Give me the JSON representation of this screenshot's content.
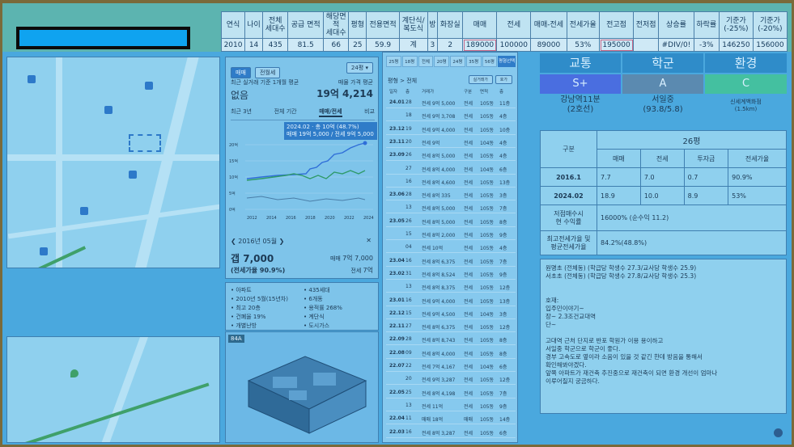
{
  "top_table": {
    "headers": [
      "연식",
      "나이",
      "전체\n세대수",
      "공급 면적",
      "해당면\n적\n세대수",
      "평형",
      "전용면적",
      "계단식/\n복도식",
      "방",
      "화장실",
      "매매",
      "전세",
      "매매-전세",
      "전세가율",
      "전고점",
      "전저점",
      "상승률",
      "하락률",
      "기준가\n(-25%)",
      "기준가\n(-20%)"
    ],
    "values": [
      "2010",
      "14",
      "435",
      "81.5",
      "66",
      "25",
      "59.9",
      "계",
      "3",
      "2",
      "189000",
      "100000",
      "89000",
      "53%",
      "195000",
      "",
      "#DIV/0!",
      "-3%",
      "146250",
      "156000"
    ]
  },
  "chart_panel": {
    "tab_sale": "매매",
    "tab_rent": "전월세",
    "size_select": "24평",
    "recent_label": "최근 실거래 기준 1개월 평균",
    "recent_value": "없음",
    "avg_label": "매물 가격 평균",
    "avg_value": "19억 4,214",
    "periods": [
      "최근 3년",
      "전체 기간",
      "매매/전세",
      "비교"
    ],
    "tooltip_line1": "2024.02 · 총 10억 (48.7%)",
    "tooltip_line2": "매매 19억 5,000 / 전세 9억 5,000",
    "y_ticks": [
      "20억",
      "15억",
      "10억",
      "5억",
      "0억"
    ],
    "x_ticks": [
      "2012",
      "2014",
      "2016",
      "2018",
      "2020",
      "2022",
      "2024"
    ],
    "month_label": "2016년 05월",
    "gap_label": "갭 7,000",
    "gap_right_label": "매매",
    "gap_right_value": "7억 7,000",
    "ratio_label": "(전세가율 90.9%)",
    "rent_right_label": "전세",
    "rent_right_value": "7억"
  },
  "info_panel": {
    "items": [
      "아파트",
      "435세대",
      "2010년 5월(15년차)",
      "6개동",
      "최고 20층",
      "용적률 268%",
      "건폐율 19%",
      "계단식",
      "개별난방",
      "도시가스"
    ]
  },
  "floor_panel": {
    "badge": "84A"
  },
  "list_panel": {
    "filters": [
      "25평",
      "18평",
      "전체",
      "20평",
      "24평",
      "35평",
      "56평"
    ],
    "active_filter": "평형선택",
    "sub_label": "평형 > 전체",
    "sub_btn1": "실거래가",
    "sub_btn2": "호가",
    "columns": [
      "일자",
      "층",
      "거래가",
      "구분",
      "면적",
      "층"
    ],
    "rows": [
      {
        "date": "24.01",
        "floor": "28",
        "price": "전세 9억 5,000",
        "type": "전세",
        "area": "105동",
        "lvl": "11층"
      },
      {
        "date": "",
        "floor": "18",
        "price": "전세 9억 3,708",
        "type": "전세",
        "area": "105동",
        "lvl": "4층"
      },
      {
        "date": "23.12",
        "floor": "19",
        "price": "전세 9억 4,000",
        "type": "전세",
        "area": "105동",
        "lvl": "10층"
      },
      {
        "date": "23.11",
        "floor": "20",
        "price": "전세 9억",
        "type": "전세",
        "area": "104동",
        "lvl": "4층"
      },
      {
        "date": "23.09",
        "floor": "26",
        "price": "전세 8억 5,000",
        "type": "전세",
        "area": "105동",
        "lvl": "4층"
      },
      {
        "date": "",
        "floor": "27",
        "price": "전세 8억 4,000",
        "type": "전세",
        "area": "104동",
        "lvl": "6층"
      },
      {
        "date": "",
        "floor": "16",
        "price": "전세 8억 4,600",
        "type": "전세",
        "area": "105동",
        "lvl": "13층"
      },
      {
        "date": "23.06",
        "floor": "28",
        "price": "전세 8억 335",
        "type": "전세",
        "area": "105동",
        "lvl": "3층"
      },
      {
        "date": "",
        "floor": "13",
        "price": "전세 8억 5,000",
        "type": "전세",
        "area": "105동",
        "lvl": "7층"
      },
      {
        "date": "23.05",
        "floor": "26",
        "price": "전세 8억 5,000",
        "type": "전세",
        "area": "105동",
        "lvl": "8층"
      },
      {
        "date": "",
        "floor": "15",
        "price": "전세 8억 2,000",
        "type": "전세",
        "area": "105동",
        "lvl": "9층"
      },
      {
        "date": "",
        "floor": "04",
        "price": "전세 10억",
        "type": "전세",
        "area": "105동",
        "lvl": "4층"
      },
      {
        "date": "23.04",
        "floor": "16",
        "price": "전세 8억 6,375",
        "type": "전세",
        "area": "105동",
        "lvl": "7층"
      },
      {
        "date": "23.02",
        "floor": "31",
        "price": "전세 8억 8,524",
        "type": "전세",
        "area": "105동",
        "lvl": "9층"
      },
      {
        "date": "",
        "floor": "13",
        "price": "전세 8억 8,375",
        "type": "전세",
        "area": "105동",
        "lvl": "12층"
      },
      {
        "date": "23.01",
        "floor": "16",
        "price": "전세 9억 4,000",
        "type": "전세",
        "area": "105동",
        "lvl": "13층"
      },
      {
        "date": "22.12",
        "floor": "15",
        "price": "전세 9억 4,500",
        "type": "전세",
        "area": "104동",
        "lvl": "3층"
      },
      {
        "date": "22.11",
        "floor": "27",
        "price": "전세 8억 6,375",
        "type": "전세",
        "area": "105동",
        "lvl": "12층"
      },
      {
        "date": "22.09",
        "floor": "28",
        "price": "전세 8억 8,743",
        "type": "전세",
        "area": "105동",
        "lvl": "8층"
      },
      {
        "date": "22.08",
        "floor": "09",
        "price": "전세 8억 4,000",
        "type": "전세",
        "area": "105동",
        "lvl": "8층"
      },
      {
        "date": "22.07",
        "floor": "22",
        "price": "전세 7억 4,167",
        "type": "전세",
        "area": "104동",
        "lvl": "6층"
      },
      {
        "date": "",
        "floor": "20",
        "price": "전세 9억 3,287",
        "type": "전세",
        "area": "105동",
        "lvl": "12층"
      },
      {
        "date": "22.05",
        "floor": "25",
        "price": "전세 8억 4,198",
        "type": "전세",
        "area": "105동",
        "lvl": "7층"
      },
      {
        "date": "",
        "floor": "13",
        "price": "전세 11억",
        "type": "전세",
        "area": "105동",
        "lvl": "9층"
      },
      {
        "date": "22.04",
        "floor": "11",
        "price": "매매 18억",
        "type": "매매",
        "area": "105동",
        "lvl": "14층"
      },
      {
        "date": "22.03",
        "floor": "16",
        "price": "전세 8억 3,287",
        "type": "전세",
        "area": "105동",
        "lvl": "6층"
      }
    ]
  },
  "grades": {
    "headers": [
      "교통",
      "학군",
      "환경"
    ],
    "values": [
      "S+",
      "A",
      "C"
    ],
    "colors": [
      "#4a6ee0",
      "#5b8ab0",
      "#44c0a0"
    ],
    "sub1_line1": "강남역11분",
    "sub1_line2": "(2호선)",
    "sub2_line1": "서일중",
    "sub2_line2": "(93.8/5.8)",
    "sub3_line1": "신세계백화점",
    "sub3_line2": "(1.5km)"
  },
  "stats": {
    "col_label": "구분",
    "size_label": "26평",
    "sub_headers": [
      "매매",
      "전세",
      "투자금",
      "전세가율"
    ],
    "rows": [
      {
        "label": "2016.1",
        "cells": [
          "7.7",
          "7.0",
          "0.7",
          "90.9%"
        ]
      },
      {
        "label": "2024.02",
        "cells": [
          "18.9",
          "10.0",
          "8.9",
          "53%"
        ]
      }
    ],
    "roi_label": "저점매수시\n현 수익률",
    "roi_value": "16000% (순수익 11.2)",
    "peak_label": "최고전세가율 및\n평균전세가율",
    "peak_value": "84.2%(48.8%)"
  },
  "notes": {
    "lines": [
      "원명초 (전체동) (학급당 학생수 27.3/교사당 학생수 25.9)",
      "서초초 (전체동) (학급당 학생수 27.8/교사당 학생수 25.3)",
      "",
      "",
      "호재:",
      "입주민이야기~",
      "장~ 2.3조건교대역",
      "단~",
      "",
      "고대역 근처 단지로 반포 학원가 이용 용이하고",
      "서일중 학군으로 학군이 좋다.",
      "경부 고속도로 옆이라 소음이 있을 것 같긴 한데 방음을 통해서",
      "확인해봐야겠다.",
      "앞쪽 아파트가 재건축 추진중으로 재건축이 되면 환경 개선이 엄마나",
      "이루어질지 궁금하다."
    ]
  }
}
